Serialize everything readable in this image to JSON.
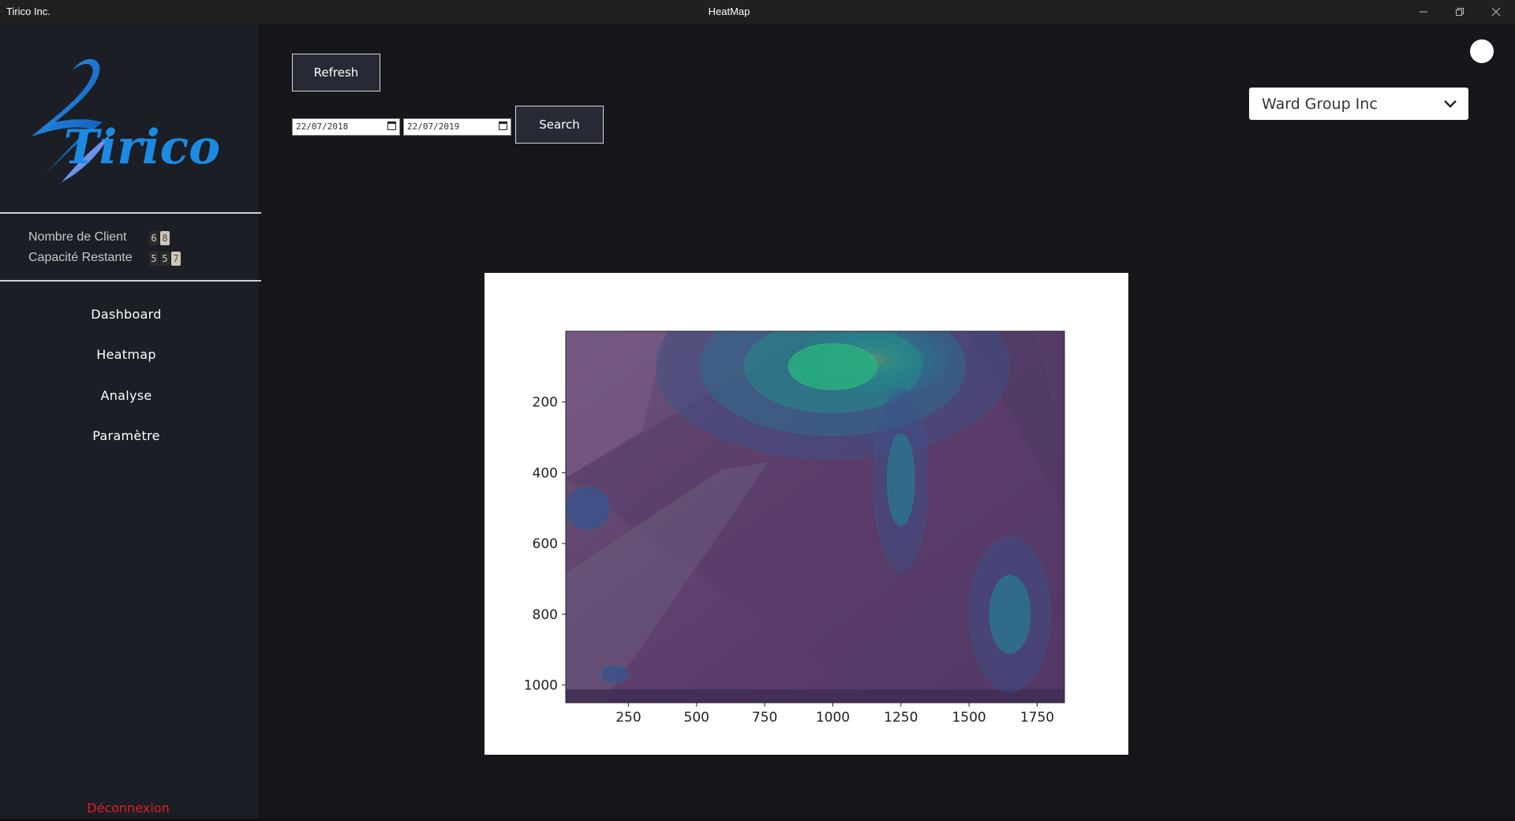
{
  "window": {
    "app_name": "Tirico Inc.",
    "title": "HeatMap",
    "controls": [
      "minimize-icon",
      "restore-icon",
      "close-icon"
    ]
  },
  "sidebar": {
    "logo_text": "Tirico",
    "stats": [
      {
        "label": "Nombre de Client",
        "digits": [
          "6",
          "8"
        ]
      },
      {
        "label": "Capacité Restante",
        "digits": [
          "5",
          "5",
          "7"
        ]
      }
    ],
    "nav": [
      "Dashboard",
      "Heatmap",
      "Analyse",
      "Paramètre"
    ],
    "logout": "Déconnexion"
  },
  "toolbar": {
    "refresh_label": "Refresh",
    "date_from": "22/07/2018",
    "date_to": "22/07/2019",
    "search_label": "Search"
  },
  "company_select": {
    "selected": "Ward Group Inc"
  },
  "colors": {
    "background": "#16171b",
    "sidebar": "#1c1e26",
    "button": "#272935",
    "logout": "#e01f1f",
    "heat_low": "#5a2e6e",
    "heat_mid": "#2a9d8f",
    "heat_high": "#fde725"
  },
  "chart_data": {
    "type": "heatmap",
    "title": "",
    "xlabel": "",
    "ylabel": "",
    "x_ticks": [
      250,
      500,
      750,
      1000,
      1250,
      1500,
      1750
    ],
    "y_ticks": [
      200,
      400,
      600,
      800,
      1000
    ],
    "xlim": [
      20,
      1850
    ],
    "ylim": [
      1050,
      0
    ],
    "y_inverted": true,
    "background": "camera frame of a pedestrian street",
    "colormap": "viridis",
    "hotspots": [
      {
        "x": 1150,
        "y": 80,
        "intensity": 1.0,
        "rx": 320,
        "ry": 120
      },
      {
        "x": 1000,
        "y": 100,
        "intensity": 0.6,
        "rx": 650,
        "ry": 260
      },
      {
        "x": 1250,
        "y": 420,
        "intensity": 0.3,
        "rx": 100,
        "ry": 260
      },
      {
        "x": 1650,
        "y": 800,
        "intensity": 0.3,
        "rx": 150,
        "ry": 220
      },
      {
        "x": 100,
        "y": 500,
        "intensity": 0.2,
        "rx": 80,
        "ry": 60
      },
      {
        "x": 200,
        "y": 970,
        "intensity": 0.15,
        "rx": 50,
        "ry": 25
      }
    ]
  }
}
